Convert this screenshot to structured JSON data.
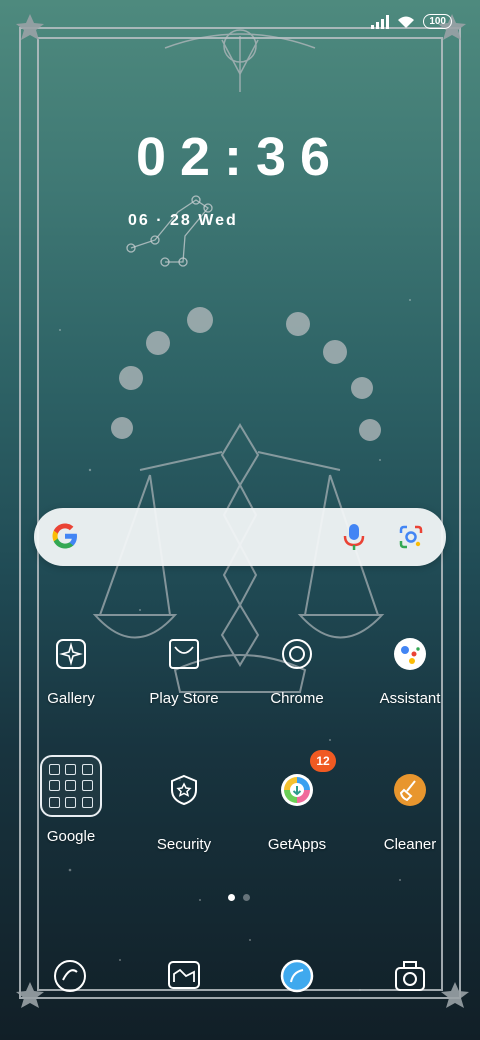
{
  "status_bar": {
    "battery": "100",
    "icons": [
      "signal-icon",
      "wifi-icon",
      "battery-icon"
    ]
  },
  "clock": {
    "time": "02:36",
    "date": "06 · 28  Wed"
  },
  "search_bar": {
    "icons": [
      "google-g-icon",
      "mic-icon",
      "google-lens-icon"
    ]
  },
  "apps_row1": [
    {
      "label": "Gallery",
      "icon": "gallery-icon"
    },
    {
      "label": "Play Store",
      "icon": "play-store-icon"
    },
    {
      "label": "Chrome",
      "icon": "chrome-icon"
    },
    {
      "label": "Assistant",
      "icon": "assistant-icon"
    }
  ],
  "apps_row2": [
    {
      "label": "Google",
      "icon": "google-folder-icon"
    },
    {
      "label": "Security",
      "icon": "security-icon"
    },
    {
      "label": "GetApps",
      "icon": "getapps-icon",
      "badge": "12"
    },
    {
      "label": "Cleaner",
      "icon": "cleaner-icon"
    }
  ],
  "page_indicator": {
    "pages": 2,
    "current": 1
  },
  "dock": [
    "phone-icon",
    "messages-icon",
    "browser-icon",
    "camera-icon"
  ],
  "colors": {
    "badge": "#f05a22",
    "bg_top": "#4e8a7e",
    "bg_bottom": "#111f27"
  }
}
